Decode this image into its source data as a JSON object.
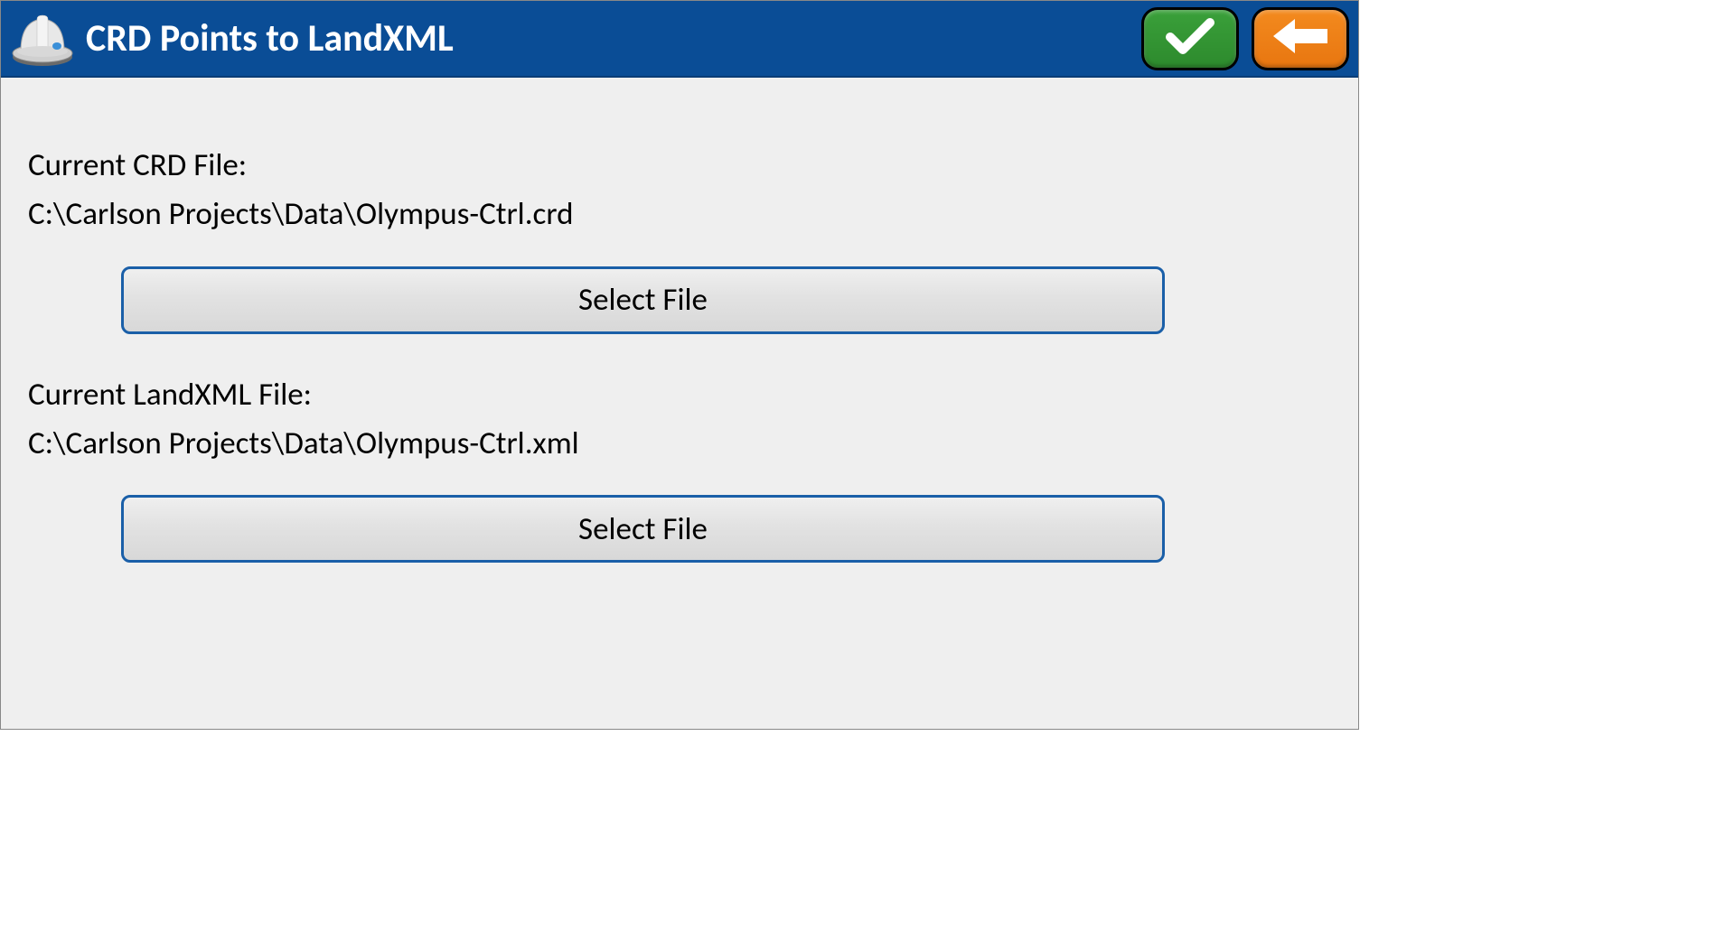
{
  "header": {
    "title": "CRD Points to LandXML"
  },
  "crd": {
    "label": "Current CRD File:",
    "path": "C:\\Carlson Projects\\Data\\Olympus-Ctrl.crd",
    "button": "Select File"
  },
  "xml": {
    "label": "Current LandXML File:",
    "path": "C:\\Carlson Projects\\Data\\Olympus-Ctrl.xml",
    "button": "Select File"
  }
}
